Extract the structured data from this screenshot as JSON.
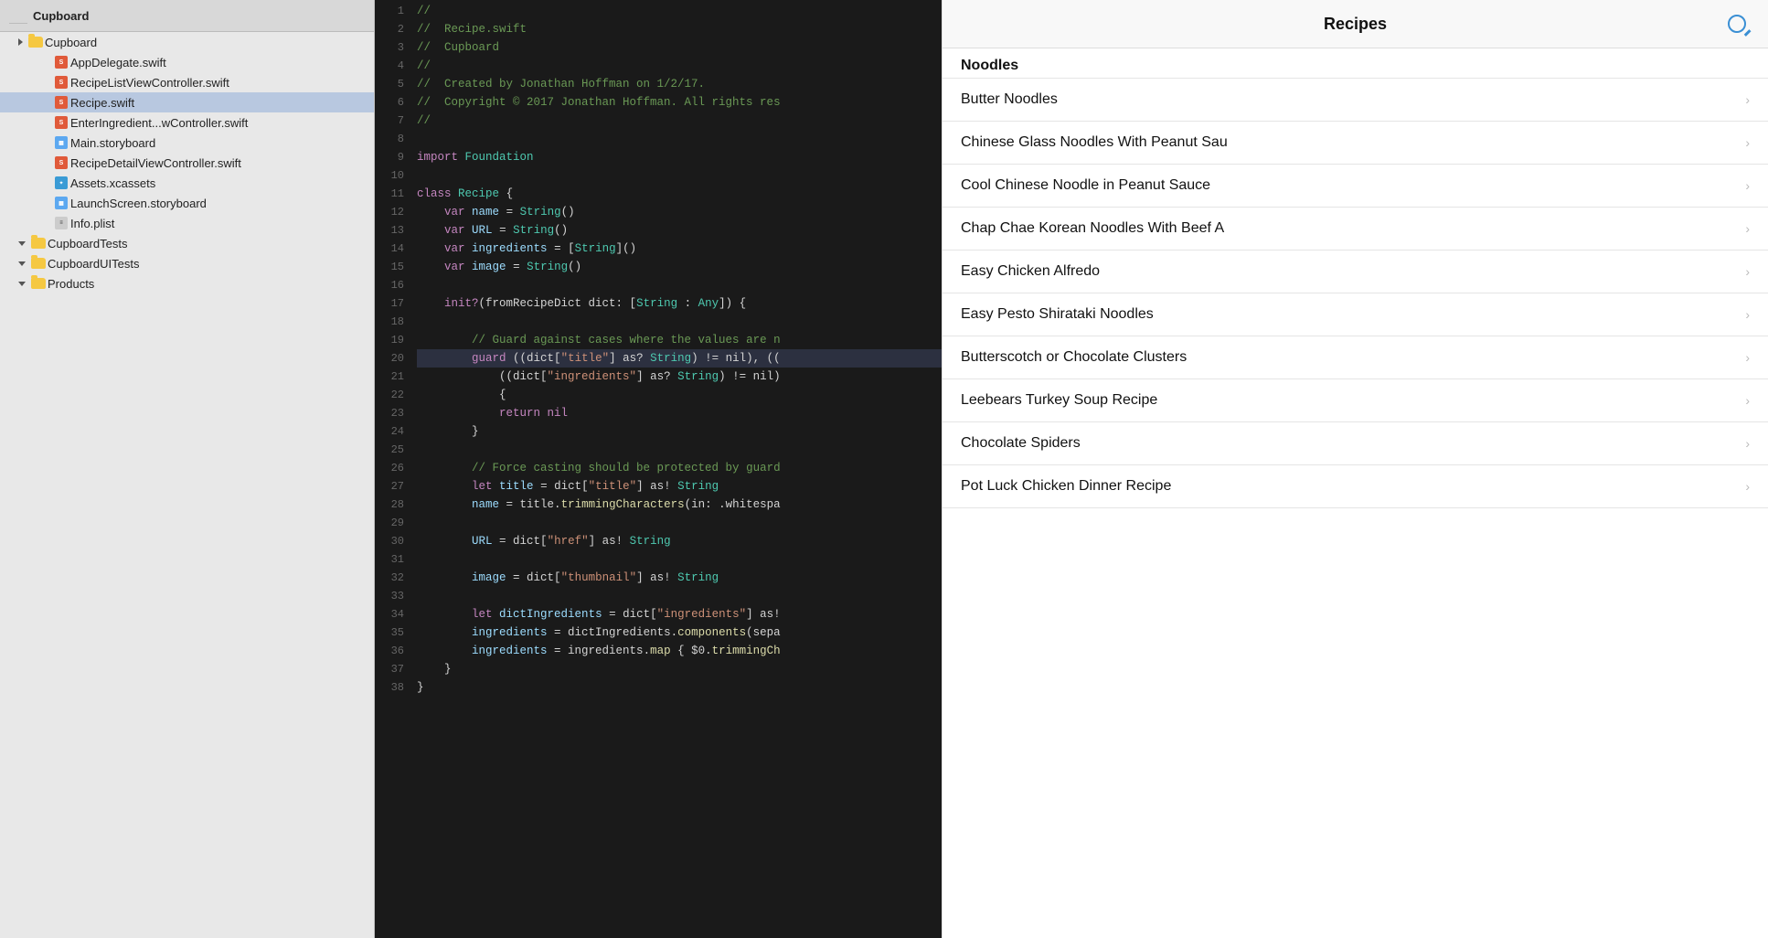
{
  "project": {
    "name": "Cupboard",
    "root_label": "Cupboard"
  },
  "file_tree": [
    {
      "id": "root-group",
      "label": "Cupboard",
      "type": "folder-yellow",
      "indent": 20,
      "has_triangle": true,
      "triangle_open": true
    },
    {
      "id": "app-delegate",
      "label": "AppDelegate.swift",
      "type": "swift",
      "indent": 44
    },
    {
      "id": "recipe-list-vc",
      "label": "RecipeListViewController.swift",
      "type": "swift",
      "indent": 44
    },
    {
      "id": "recipe-swift",
      "label": "Recipe.swift",
      "type": "swift",
      "indent": 44,
      "selected": true
    },
    {
      "id": "enter-ingredient",
      "label": "EnterIngredient...wController.swift",
      "type": "swift",
      "indent": 44
    },
    {
      "id": "main-storyboard",
      "label": "Main.storyboard",
      "type": "storyboard",
      "indent": 44
    },
    {
      "id": "recipe-detail-vc",
      "label": "RecipeDetailViewController.swift",
      "type": "swift",
      "indent": 44
    },
    {
      "id": "assets",
      "label": "Assets.xcassets",
      "type": "xcassets",
      "indent": 44
    },
    {
      "id": "launch-screen",
      "label": "LaunchScreen.storyboard",
      "type": "storyboard",
      "indent": 44
    },
    {
      "id": "info-plist",
      "label": "Info.plist",
      "type": "plist",
      "indent": 44
    },
    {
      "id": "cupboard-tests",
      "label": "CupboardTests",
      "type": "folder-yellow",
      "indent": 20,
      "has_triangle": true,
      "triangle_open": false
    },
    {
      "id": "cupboard-ui-tests",
      "label": "CupboardUITests",
      "type": "folder-yellow",
      "indent": 20,
      "has_triangle": true,
      "triangle_open": false
    },
    {
      "id": "products",
      "label": "Products",
      "type": "folder-yellow",
      "indent": 20,
      "has_triangle": true,
      "triangle_open": false
    }
  ],
  "code_lines": [
    {
      "num": 1,
      "content": "//"
    },
    {
      "num": 2,
      "content": "//  Recipe.swift"
    },
    {
      "num": 3,
      "content": "//  Cupboard"
    },
    {
      "num": 4,
      "content": "//"
    },
    {
      "num": 5,
      "content": "//  Created by Jonathan Hoffman on 1/2/17."
    },
    {
      "num": 6,
      "content": "//  Copyright © 2017 Jonathan Hoffman. All rights res"
    },
    {
      "num": 7,
      "content": "//"
    },
    {
      "num": 8,
      "content": ""
    },
    {
      "num": 9,
      "content": "import Foundation"
    },
    {
      "num": 10,
      "content": ""
    },
    {
      "num": 11,
      "content": "class Recipe {"
    },
    {
      "num": 12,
      "content": "    var name = String()"
    },
    {
      "num": 13,
      "content": "    var URL = String()"
    },
    {
      "num": 14,
      "content": "    var ingredients = [String]()"
    },
    {
      "num": 15,
      "content": "    var image = String()"
    },
    {
      "num": 16,
      "content": ""
    },
    {
      "num": 17,
      "content": "    init?(fromRecipeDict dict: [String : Any]) {"
    },
    {
      "num": 18,
      "content": ""
    },
    {
      "num": 19,
      "content": "        // Guard against cases where the values are n"
    },
    {
      "num": 20,
      "content": "        guard ((dict[\"title\"] as? String) != nil), (("
    },
    {
      "num": 21,
      "content": "            ((dict[\"ingredients\"] as? String) != nil)"
    },
    {
      "num": 22,
      "content": "            {"
    },
    {
      "num": 23,
      "content": "            return nil"
    },
    {
      "num": 24,
      "content": "        }"
    },
    {
      "num": 25,
      "content": ""
    },
    {
      "num": 26,
      "content": "        // Force casting should be protected by guard"
    },
    {
      "num": 27,
      "content": "        let title = dict[\"title\"] as! String"
    },
    {
      "num": 28,
      "content": "        name = title.trimmingCharacters(in: .whitespa"
    },
    {
      "num": 29,
      "content": ""
    },
    {
      "num": 30,
      "content": "        URL = dict[\"href\"] as! String"
    },
    {
      "num": 31,
      "content": ""
    },
    {
      "num": 32,
      "content": "        image = dict[\"thumbnail\"] as! String"
    },
    {
      "num": 33,
      "content": ""
    },
    {
      "num": 34,
      "content": "        let dictIngredients = dict[\"ingredients\"] as!"
    },
    {
      "num": 35,
      "content": "        ingredients = dictIngredients.components(sepa"
    },
    {
      "num": 36,
      "content": "        ingredients = ingredients.map { $0.trimmingCh"
    },
    {
      "num": 37,
      "content": "    }"
    },
    {
      "num": 38,
      "content": "}"
    }
  ],
  "recipes": {
    "title": "Recipes",
    "search_placeholder": "Search",
    "sections": [
      {
        "id": "noodles",
        "label": "Noodles",
        "items": [
          {
            "id": "butter-noodles",
            "name": "Butter Noodles"
          },
          {
            "id": "chinese-glass-noodles",
            "name": "Chinese Glass Noodles With Peanut Sau"
          },
          {
            "id": "cool-chinese-noodle",
            "name": "Cool Chinese Noodle in Peanut Sauce"
          },
          {
            "id": "chap-chae-korean",
            "name": "Chap Chae Korean Noodles With Beef A"
          },
          {
            "id": "easy-chicken-alfredo",
            "name": "Easy Chicken Alfredo"
          },
          {
            "id": "easy-pesto-shirataki",
            "name": "Easy Pesto Shirataki Noodles"
          },
          {
            "id": "butterscotch-clusters",
            "name": "Butterscotch or Chocolate Clusters"
          },
          {
            "id": "leebears-turkey-soup",
            "name": "Leebears Turkey Soup Recipe"
          },
          {
            "id": "chocolate-spiders",
            "name": "Chocolate Spiders"
          },
          {
            "id": "pot-luck-chicken",
            "name": "Pot Luck Chicken Dinner Recipe"
          }
        ]
      }
    ]
  }
}
